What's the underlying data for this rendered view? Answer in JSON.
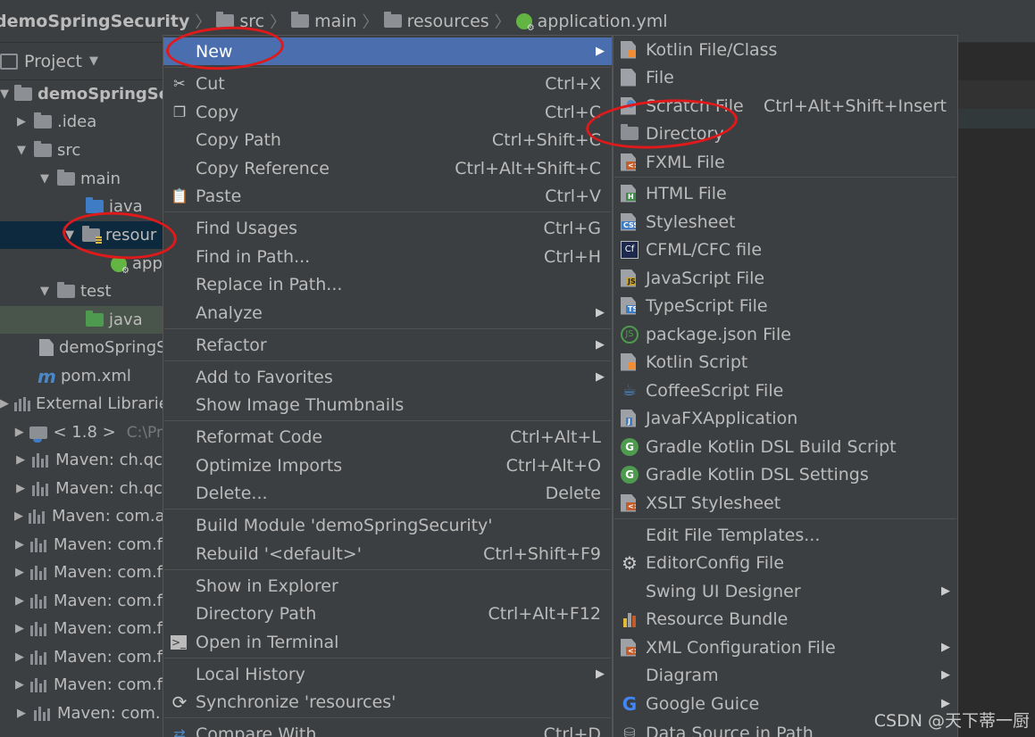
{
  "breadcrumb": {
    "items": [
      "demoSpringSecurity",
      "src",
      "main",
      "resources",
      "application.yml"
    ]
  },
  "project_panel": {
    "title": "Project",
    "tree": [
      {
        "label": "demoSpringSec",
        "type": "module"
      },
      {
        "label": ".idea",
        "type": "folder"
      },
      {
        "label": "src",
        "type": "folder"
      },
      {
        "label": "main",
        "type": "folder"
      },
      {
        "label": "java",
        "type": "folder"
      },
      {
        "label": "resour",
        "type": "resources"
      },
      {
        "label": "app",
        "type": "yml"
      },
      {
        "label": "test",
        "type": "folder"
      },
      {
        "label": "java",
        "type": "test-folder"
      },
      {
        "label": "demoSpringS",
        "type": "file"
      },
      {
        "label": "pom.xml",
        "type": "maven"
      },
      {
        "label": "External Librarie",
        "type": "libs"
      },
      {
        "label": "< 1.8 >",
        "extra": "C:\\Pr",
        "type": "jdk"
      },
      {
        "label": "Maven: ch.qc",
        "type": "mvn"
      },
      {
        "label": "Maven: ch.qc",
        "type": "mvn"
      },
      {
        "label": "Maven: com.a",
        "type": "mvn"
      },
      {
        "label": "Maven: com.f",
        "type": "mvn"
      },
      {
        "label": "Maven: com.f",
        "type": "mvn"
      },
      {
        "label": "Maven: com.f",
        "type": "mvn"
      },
      {
        "label": "Maven: com.f",
        "type": "mvn"
      },
      {
        "label": "Maven: com.f",
        "type": "mvn"
      },
      {
        "label": "Maven: com.f",
        "type": "mvn"
      },
      {
        "label": "Maven: com.",
        "type": "mvn"
      }
    ]
  },
  "context_menu": {
    "items": [
      {
        "label": "New",
        "shortcut": "",
        "submenu": true
      },
      {
        "label": "Cut",
        "shortcut": "Ctrl+X",
        "icon": "scissors-icon"
      },
      {
        "label": "Copy",
        "shortcut": "Ctrl+C",
        "icon": "copy-icon"
      },
      {
        "label": "Copy Path",
        "shortcut": "Ctrl+Shift+C"
      },
      {
        "label": "Copy Reference",
        "shortcut": "Ctrl+Alt+Shift+C"
      },
      {
        "label": "Paste",
        "shortcut": "Ctrl+V",
        "icon": "paste-icon"
      },
      {
        "label": "Find Usages",
        "shortcut": "Ctrl+G"
      },
      {
        "label": "Find in Path...",
        "shortcut": "Ctrl+H"
      },
      {
        "label": "Replace in Path...",
        "shortcut": ""
      },
      {
        "label": "Analyze",
        "shortcut": "",
        "submenu": true
      },
      {
        "label": "Refactor",
        "shortcut": "",
        "submenu": true
      },
      {
        "label": "Add to Favorites",
        "shortcut": "",
        "submenu": true
      },
      {
        "label": "Show Image Thumbnails",
        "shortcut": ""
      },
      {
        "label": "Reformat Code",
        "shortcut": "Ctrl+Alt+L"
      },
      {
        "label": "Optimize Imports",
        "shortcut": "Ctrl+Alt+O"
      },
      {
        "label": "Delete...",
        "shortcut": "Delete"
      },
      {
        "label": "Build Module 'demoSpringSecurity'",
        "shortcut": ""
      },
      {
        "label": "Rebuild '<default>'",
        "shortcut": "Ctrl+Shift+F9"
      },
      {
        "label": "Show in Explorer",
        "shortcut": ""
      },
      {
        "label": "Directory Path",
        "shortcut": "Ctrl+Alt+F12"
      },
      {
        "label": "Open in Terminal",
        "shortcut": "",
        "icon": "terminal-icon"
      },
      {
        "label": "Local History",
        "shortcut": "",
        "submenu": true
      },
      {
        "label": "Synchronize 'resources'",
        "shortcut": "",
        "icon": "sync-icon"
      },
      {
        "label": "Compare With...",
        "shortcut": "Ctrl+D",
        "icon": "compare-icon"
      }
    ]
  },
  "new_submenu": {
    "items": [
      {
        "label": "Kotlin File/Class",
        "shortcut": ""
      },
      {
        "label": "File",
        "shortcut": ""
      },
      {
        "label": "Scratch File",
        "shortcut": "Ctrl+Alt+Shift+Insert"
      },
      {
        "label": "Directory",
        "shortcut": ""
      },
      {
        "label": "FXML File",
        "shortcut": ""
      },
      {
        "label": "HTML File",
        "shortcut": ""
      },
      {
        "label": "Stylesheet",
        "shortcut": ""
      },
      {
        "label": "CFML/CFC file",
        "shortcut": ""
      },
      {
        "label": "JavaScript File",
        "shortcut": ""
      },
      {
        "label": "TypeScript File",
        "shortcut": ""
      },
      {
        "label": "package.json File",
        "shortcut": ""
      },
      {
        "label": "Kotlin Script",
        "shortcut": ""
      },
      {
        "label": "CoffeeScript File",
        "shortcut": ""
      },
      {
        "label": "JavaFXApplication",
        "shortcut": ""
      },
      {
        "label": "Gradle Kotlin DSL Build Script",
        "shortcut": ""
      },
      {
        "label": "Gradle Kotlin DSL Settings",
        "shortcut": ""
      },
      {
        "label": "XSLT Stylesheet",
        "shortcut": ""
      },
      {
        "label": "Edit File Templates...",
        "shortcut": ""
      },
      {
        "label": "EditorConfig File",
        "shortcut": ""
      },
      {
        "label": "Swing UI Designer",
        "shortcut": "",
        "submenu": true
      },
      {
        "label": "Resource Bundle",
        "shortcut": ""
      },
      {
        "label": "XML Configuration File",
        "shortcut": "",
        "submenu": true
      },
      {
        "label": "Diagram",
        "shortcut": "",
        "submenu": true
      },
      {
        "label": "Google Guice",
        "shortcut": "",
        "submenu": true
      },
      {
        "label": "Data Source in Path",
        "shortcut": ""
      }
    ],
    "badges": {
      "html": "H",
      "css": "CSS",
      "cf": "Cf",
      "js": "JS",
      "ts": "TS",
      "gradle": "G",
      "xml": "<>",
      "fxml": "<>"
    }
  },
  "watermark": "CSDN @天下蒂一厨"
}
